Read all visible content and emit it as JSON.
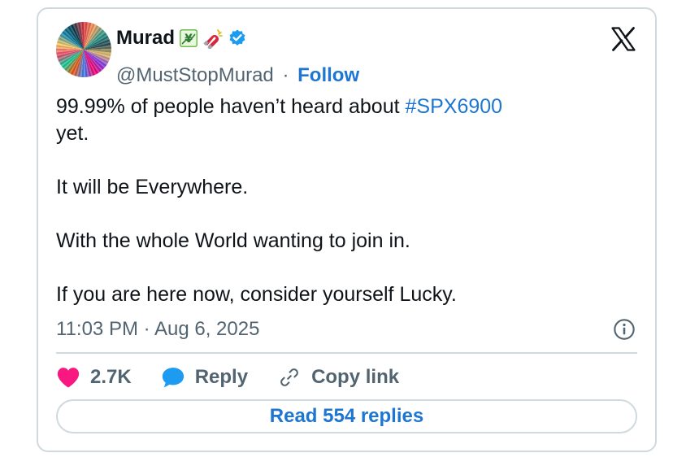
{
  "author": {
    "name": "Murad",
    "handle": "@MustStopMurad",
    "separator": "·",
    "follow_label": "Follow",
    "badges": [
      "chart-emoji-icon",
      "magnet-emoji-icon",
      "verified-badge-icon"
    ]
  },
  "tweet": {
    "line1_prefix": "99.99% of people haven’t heard about ",
    "hashtag": "#SPX6900",
    "line1_suffix": "yet.",
    "para2": "It will be Everywhere.",
    "para3": "With the whole World wanting to join in.",
    "para4": "If you are here now, consider yourself Lucky."
  },
  "meta": {
    "time": "11:03 PM",
    "separator": "·",
    "date": "Aug 6, 2025"
  },
  "actions": {
    "likes": "2.7K",
    "reply_label": "Reply",
    "copy_link_label": "Copy link"
  },
  "read_replies_label": "Read 554 replies",
  "colors": {
    "accent": "#1d76d2",
    "like": "#f91880",
    "reply_icon": "#1d9bf0",
    "muted": "#536471",
    "border": "#cfd9de"
  }
}
